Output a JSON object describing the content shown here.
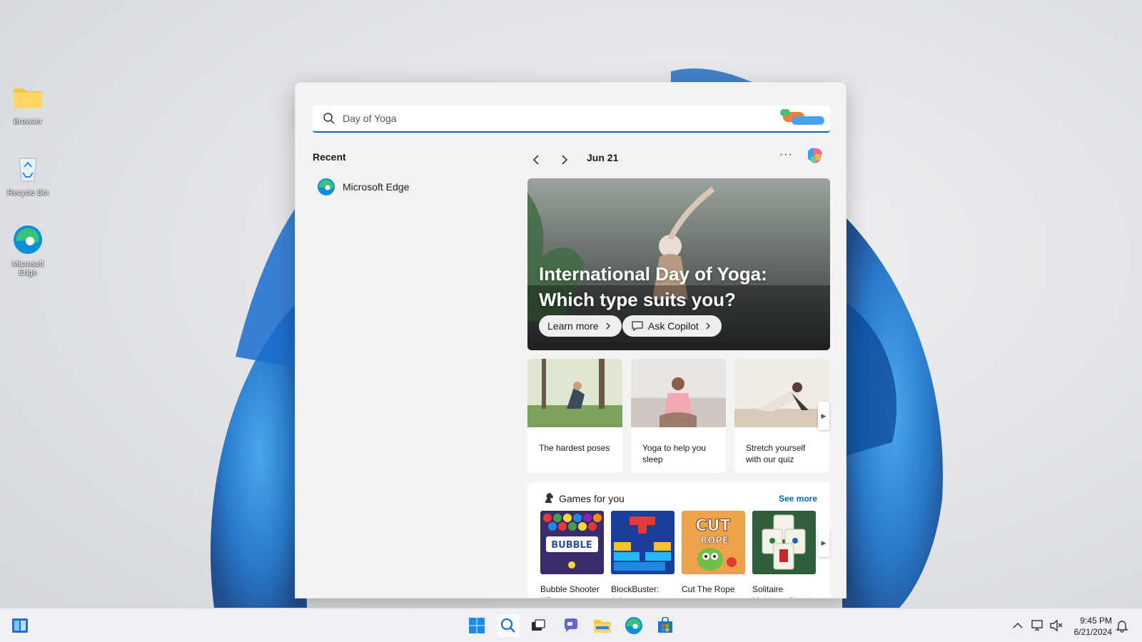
{
  "desktop": {
    "icons": [
      {
        "label": "Browser",
        "icon": "folder-icon"
      },
      {
        "label": "Recycle Bin",
        "icon": "recycle-bin-icon"
      },
      {
        "label": "Microsoft Edge",
        "icon": "edge-icon"
      }
    ]
  },
  "search": {
    "value": "Day of Yoga",
    "placeholder": "Day of Yoga"
  },
  "recent": {
    "label": "Recent",
    "items": [
      {
        "label": "Microsoft Edge",
        "icon": "edge-icon"
      }
    ]
  },
  "highlights": {
    "date": "Jun 21",
    "more": "···",
    "hero": {
      "title": "International Day of Yoga: Which type suits you?",
      "learn_more": "Learn more",
      "ask_copilot": "Ask Copilot"
    },
    "cards": [
      {
        "caption": "The hardest poses"
      },
      {
        "caption": "Yoga to help you sleep"
      },
      {
        "caption": "Stretch yourself with our quiz"
      }
    ]
  },
  "games": {
    "title": "Games for you",
    "see_more": "See more",
    "items": [
      {
        "name": "Bubble Shooter HD"
      },
      {
        "name": "BlockBuster: Adventures ..."
      },
      {
        "name": "Cut The Rope"
      },
      {
        "name": "Solitaire Mahjong Classic"
      }
    ]
  },
  "taskbar": {
    "time": "9:45 PM",
    "date": "6/21/2024"
  },
  "colors": {
    "accent": "#0067c0",
    "wallpaper_petal": "#1f7fd6"
  }
}
